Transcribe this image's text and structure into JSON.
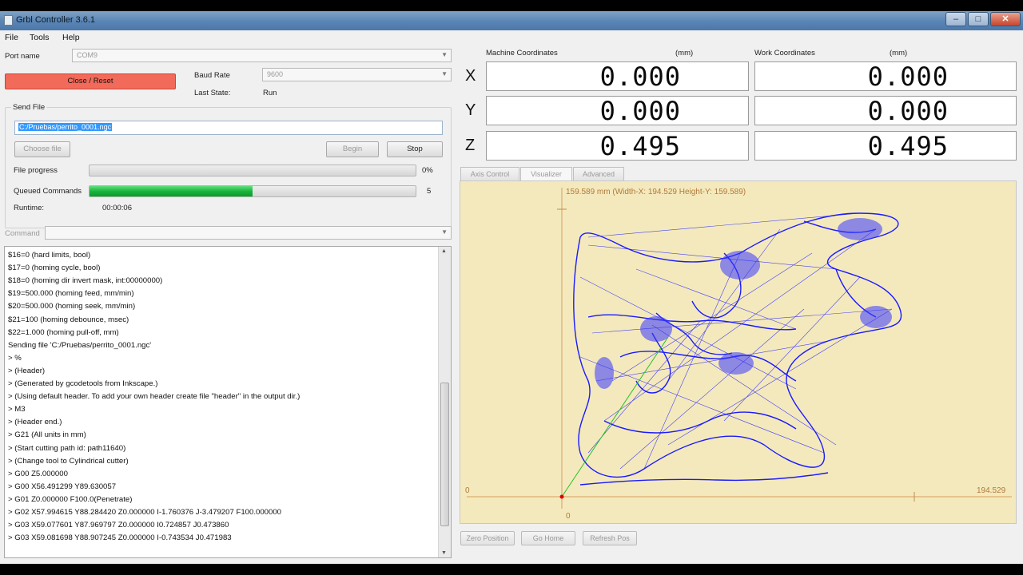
{
  "window": {
    "title": "Grbl Controller 3.6.1",
    "minimize": "–",
    "maximize": "□",
    "close": "✕"
  },
  "menu": [
    "File",
    "Tools",
    "Help"
  ],
  "connection": {
    "port_label": "Port name",
    "port_value": "COM9",
    "reset_button": "Close / Reset",
    "baud_label": "Baud Rate",
    "baud_value": "9600",
    "state_label": "Last State:",
    "state_value": "Run"
  },
  "send_file": {
    "group_label": "Send File",
    "file_path": "C:/Pruebas/perrito_0001.ngc",
    "choose_button": "Choose file",
    "begin_button": "Begin",
    "stop_button": "Stop",
    "file_progress_label": "File progress",
    "file_progress_value": "0%",
    "file_progress_fraction": 0,
    "queued_label": "Queued Commands",
    "queued_value": "5",
    "queued_fraction": 0.5,
    "runtime_label": "Runtime:",
    "runtime_value": "00:00:06"
  },
  "command": {
    "label": "Command",
    "placeholder": ""
  },
  "console_lines": [
    "$16=0 (hard limits, bool)",
    "$17=0 (homing cycle, bool)",
    "$18=0 (homing dir invert mask, int:00000000)",
    "$19=500.000 (homing feed, mm/min)",
    "$20=500.000 (homing seek, mm/min)",
    "$21=100 (homing debounce, msec)",
    "$22=1.000 (homing pull-off, mm)",
    "Sending file 'C:/Pruebas/perrito_0001.ngc'",
    "> %",
    "> (Header)",
    "> (Generated by gcodetools from Inkscape.)",
    "> (Using default header. To add your own header create file \"header\" in the output dir.)",
    "> M3",
    "> (Header end.)",
    "> G21 (All units in mm)",
    "> (Start cutting path id: path11640)",
    "> (Change tool to Cylindrical cutter)",
    "> G00 Z5.000000",
    "> G00 X56.491299 Y89.630057",
    "> G01 Z0.000000 F100.0(Penetrate)",
    "> G02 X57.994615 Y88.284420 Z0.000000 I-1.760376 J-3.479207 F100.000000",
    "> G03 X59.077601 Y87.969797 Z0.000000 I0.724857 J0.473860",
    "> G03 X59.081698 Y88.907245 Z0.000000 I-0.743534 J0.471983"
  ],
  "coordinates": {
    "machine_label": "Machine Coordinates",
    "machine_unit": "(mm)",
    "work_label": "Work Coordinates",
    "work_unit": "(mm)",
    "axes": [
      {
        "name": "X",
        "machine": "0.000",
        "work": "0.000"
      },
      {
        "name": "Y",
        "machine": "0.000",
        "work": "0.000"
      },
      {
        "name": "Z",
        "machine": "0.495",
        "work": "0.495"
      }
    ]
  },
  "tabs": [
    "Axis Control",
    "Visualizer",
    "Advanced"
  ],
  "visualizer": {
    "header": "159.589 mm  (Width-X: 194.529  Height-Y: 159.589)",
    "x_zero": "0",
    "y_zero": "0",
    "x_max": "194.529",
    "colors": {
      "background": "#f4e9bd",
      "path": "#1a1aff",
      "axis": "#d9a060",
      "traverse": "#2dbb2d"
    }
  },
  "bottom_buttons": [
    "Zero Position",
    "Go Home",
    "Refresh Pos"
  ]
}
